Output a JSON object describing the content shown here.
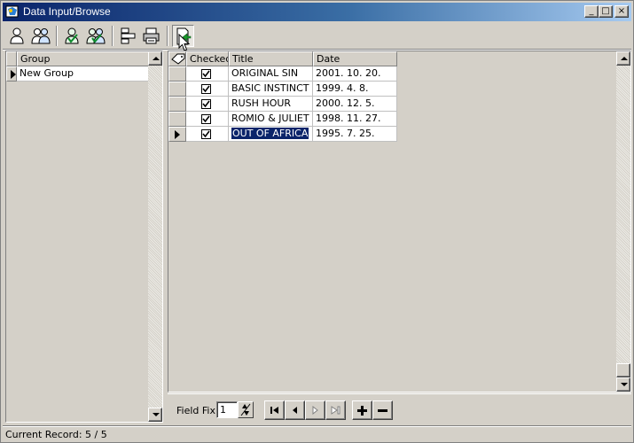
{
  "window": {
    "title": "Data Input/Browse",
    "controls": {
      "minimize": "_",
      "maximize": "□",
      "close": "×"
    }
  },
  "toolbar": {
    "buttons": [
      {
        "icon": "user-icon"
      },
      {
        "icon": "users-icon"
      },
      {
        "icon": "user-check-icon"
      },
      {
        "icon": "users-check-icon"
      },
      {
        "icon": "layout-icon"
      },
      {
        "icon": "printer-icon"
      },
      {
        "icon": "export-document-icon",
        "pressed": true
      }
    ]
  },
  "group_grid": {
    "header": "Group",
    "rows": [
      {
        "name": "New Group",
        "current": true
      }
    ]
  },
  "records_grid": {
    "columns": {
      "checked": "Checked",
      "title": "Title",
      "date": "Date"
    },
    "rows": [
      {
        "checked": true,
        "title": "ORIGINAL SIN",
        "date": "2001. 10. 20.",
        "current": false
      },
      {
        "checked": true,
        "title": "BASIC INSTINCT",
        "date": "1999. 4. 8.",
        "current": false
      },
      {
        "checked": true,
        "title": "RUSH HOUR",
        "date": "2000. 12. 5.",
        "current": false
      },
      {
        "checked": true,
        "title": "ROMIO & JULIET",
        "date": "1998. 11. 27.",
        "current": false
      },
      {
        "checked": true,
        "title": "OUT OF AFRICA",
        "date": "1995. 7. 25.",
        "current": true
      }
    ]
  },
  "navigator": {
    "field_fix_label": "Field Fix:",
    "field_fix_value": "1"
  },
  "statusbar": {
    "text": "Current Record: 5 / 5"
  },
  "colors": {
    "face": "#d4d0c8",
    "title_start": "#0a246a",
    "title_end": "#a6caf0",
    "selection": "#0a246a"
  }
}
